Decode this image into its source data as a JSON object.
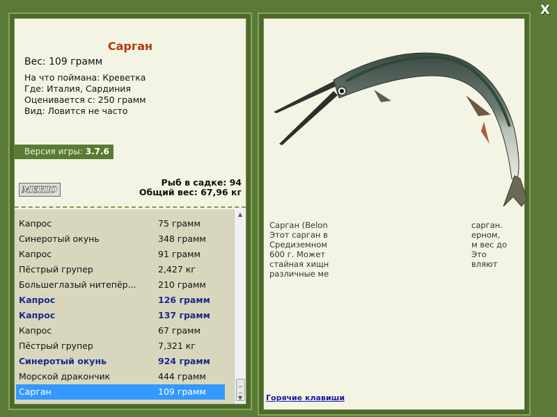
{
  "close_label": "X",
  "fish": {
    "title": "Сарган",
    "weight": "Вес: 109 грамм",
    "caught_on": "На что поймана: Креветка",
    "location": "Где: Италия, Сардиния",
    "valued_from": "Оценивается с: 250 грамм",
    "rarity": "Вид: Ловится не часто"
  },
  "version": {
    "label": "Версия игры:",
    "value": "3.7.6"
  },
  "menu_logo": "МЕНЮ",
  "stats": {
    "fish_in_cage": "Рыб в садке: 94",
    "total_weight": "Общий вес: 67,96 кг"
  },
  "catch_list": [
    {
      "name": "Капрос",
      "weight": "75 грамм",
      "bold": false,
      "selected": false
    },
    {
      "name": "Синеротый окунь",
      "weight": "348 грамм",
      "bold": false,
      "selected": false
    },
    {
      "name": "Капрос",
      "weight": "91 грамм",
      "bold": false,
      "selected": false
    },
    {
      "name": "Пёстрый групер",
      "weight": "2,427 кг",
      "bold": false,
      "selected": false
    },
    {
      "name": "Большеглазый нитепёр...",
      "weight": "210 грамм",
      "bold": false,
      "selected": false
    },
    {
      "name": "Капрос",
      "weight": "126 грамм",
      "bold": true,
      "selected": false
    },
    {
      "name": "Капрос",
      "weight": "137 грамм",
      "bold": true,
      "selected": false
    },
    {
      "name": "Капрос",
      "weight": "67 грамм",
      "bold": false,
      "selected": false
    },
    {
      "name": "Пёстрый групер",
      "weight": "7,321 кг",
      "bold": false,
      "selected": false
    },
    {
      "name": "Синеротый окунь",
      "weight": "924 грамм",
      "bold": true,
      "selected": false
    },
    {
      "name": "Морской дракончик",
      "weight": "444 грамм",
      "bold": false,
      "selected": false
    },
    {
      "name": "Сарган",
      "weight": "109 грамм",
      "bold": false,
      "selected": true
    }
  ],
  "description": [
    {
      "left": "Сарган (Belon",
      "right": "сарган."
    },
    {
      "left": "Этот сарган в",
      "right": "ерном,"
    },
    {
      "left": "Средиземном",
      "right": "м вес до"
    },
    {
      "left": "600 г. Может",
      "right": "Это"
    },
    {
      "left": "стайная хищн",
      "right": "вляют"
    },
    {
      "left": "различные ме",
      "right": ""
    }
  ],
  "hotkeys_link": "Горячие клавиши",
  "colors": {
    "background": "#5a7a36",
    "panel": "#f4f4e4",
    "list_bg": "#d8d7be",
    "title": "#b03a08",
    "bold_entry": "#1a2a8a",
    "selection": "#3399ff"
  }
}
